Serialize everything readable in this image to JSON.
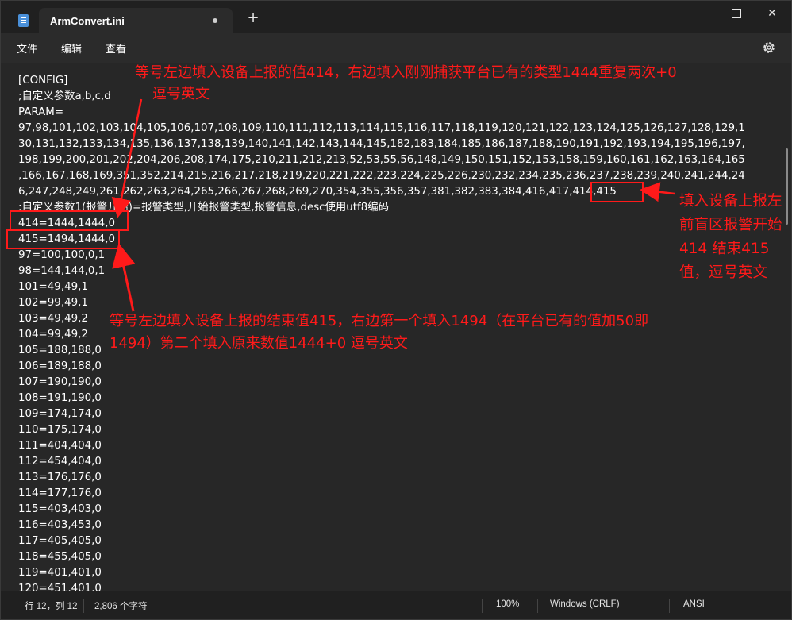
{
  "window": {
    "tab_title": "ArmConvert.ini",
    "new_tab": "+",
    "close_symbol": "✕"
  },
  "menu": {
    "file": "文件",
    "edit": "编辑",
    "view": "查看"
  },
  "editor_lines": [
    "[CONFIG]",
    ";自定义参数a,b,c,d",
    "PARAM=",
    "97,98,101,102,103,104,105,106,107,108,109,110,111,112,113,114,115,116,117,118,119,120,121,122,123,124,125,126,127,128,129,1",
    "30,131,132,133,134,135,136,137,138,139,140,141,142,143,144,145,182,183,184,185,186,187,188,190,191,192,193,194,195,196,197,",
    "198,199,200,201,202,204,206,208,174,175,210,211,212,213,52,53,55,56,148,149,150,151,152,153,158,159,160,161,162,163,164,165",
    ",166,167,168,169,351,352,214,215,216,217,218,219,220,221,222,223,224,225,226,230,232,234,235,236,237,238,239,240,241,244,24",
    "6,247,248,249,261,262,263,264,265,266,267,268,269,270,354,355,356,357,381,382,383,384,416,417,414,415",
    ";自定义参数1(报警开始)=报警类型,开始报警类型,报警信息,desc使用utf8编码",
    "414=1444,1444,0",
    "415=1494,1444,0",
    "97=100,100,0,1",
    "98=144,144,0,1",
    "101=49,49,1",
    "102=99,49,1",
    "103=49,49,2",
    "104=99,49,2",
    "105=188,188,0",
    "106=189,188,0",
    "107=190,190,0",
    "108=191,190,0",
    "109=174,174,0",
    "110=175,174,0",
    "111=404,404,0",
    "112=454,404,0",
    "113=176,176,0",
    "114=177,176,0",
    "115=403,403,0",
    "116=403,453,0",
    "117=405,405,0",
    "118=455,405,0",
    "119=401,401,0",
    "120=451,401,0"
  ],
  "status": {
    "position": "行 12，列 12",
    "char_count": "2,806 个字符",
    "zoom": "100%",
    "line_ending": "Windows (CRLF)",
    "encoding": "ANSI"
  },
  "annotations": {
    "top_line1": "等号左边填入设备上报的值414，右边填入刚刚捕获平台已有的类型1444重复两次+0",
    "top_line2": "逗号英文",
    "right": "填入设备上报左前盲区报警开始414 结束415值，逗号英文",
    "bottom_line1": "等号左边填入设备上报的结束值415，右边第一个填入1494（在平台已有的值加50即",
    "bottom_line2": "1494）第二个填入原来数值1444+0  逗号英文"
  },
  "colors": {
    "annotation": "#ff1a1a",
    "editor_bg": "#272727",
    "chrome_bg": "#202020"
  }
}
